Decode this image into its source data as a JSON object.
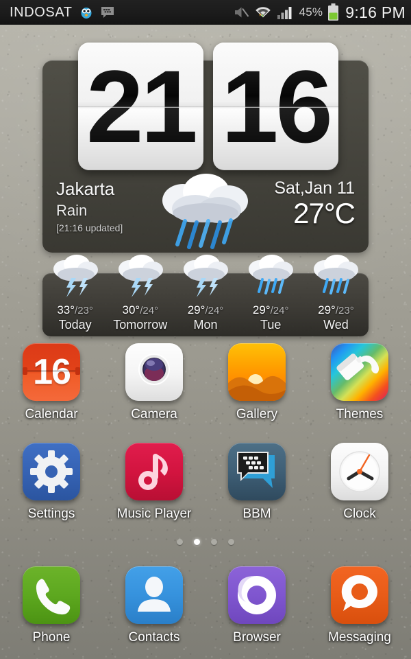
{
  "status_bar": {
    "carrier": "INDOSAT",
    "icons_left": [
      "twitter-bird-icon",
      "bbm-notification-icon"
    ],
    "icons_right": [
      "mute-icon",
      "wifi-data-icon",
      "signal-bars-icon",
      "battery-icon"
    ],
    "battery_percent": "45%",
    "time": "9:16 PM"
  },
  "clock_widget": {
    "hours": "21",
    "minutes": "16",
    "city": "Jakarta",
    "condition": "Rain",
    "updated": "[21:16 updated]",
    "date": "Sat,Jan 11",
    "temperature": "27°C",
    "weather_icon": "rain-cloud-icon"
  },
  "forecast": [
    {
      "high": "33°",
      "low": "/23°",
      "label": "Today",
      "icon": "thunderstorm-icon"
    },
    {
      "high": "30°",
      "low": "/24°",
      "label": "Tomorrow",
      "icon": "thunderstorm-icon"
    },
    {
      "high": "29°",
      "low": "/24°",
      "label": "Mon",
      "icon": "thunderstorm-icon"
    },
    {
      "high": "29°",
      "low": "/24°",
      "label": "Tue",
      "icon": "rain-icon"
    },
    {
      "high": "29°",
      "low": "/23°",
      "label": "Wed",
      "icon": "rain-icon"
    }
  ],
  "apps": {
    "row1": [
      {
        "label": "Calendar",
        "icon": "calendar-icon",
        "badge": "16",
        "color": "#dc3a17"
      },
      {
        "label": "Camera",
        "icon": "camera-icon",
        "color": "#f4f4f4"
      },
      {
        "label": "Gallery",
        "icon": "gallery-icon",
        "color": "#ffa000"
      },
      {
        "label": "Themes",
        "icon": "themes-paintbrush-icon",
        "color": "#26c6da"
      }
    ],
    "row2": [
      {
        "label": "Settings",
        "icon": "gear-icon",
        "color": "#3663b4"
      },
      {
        "label": "Music Player",
        "icon": "music-note-icon",
        "color": "#d2143f"
      },
      {
        "label": "BBM",
        "icon": "bbm-icon",
        "color": "#3f5f76"
      },
      {
        "label": "Clock",
        "icon": "analog-clock-icon",
        "color": "#f2f2f2"
      }
    ],
    "row3": [
      {
        "label": "Phone",
        "icon": "phone-handset-icon",
        "color": "#5da81f"
      },
      {
        "label": "Contacts",
        "icon": "person-icon",
        "color": "#3692dd"
      },
      {
        "label": "Browser",
        "icon": "browser-swirl-icon",
        "color": "#7f56cf"
      },
      {
        "label": "Messaging",
        "icon": "speech-bubble-icon",
        "color": "#e85c18"
      }
    ]
  },
  "page_indicator": {
    "total": 4,
    "active_index": 1
  }
}
